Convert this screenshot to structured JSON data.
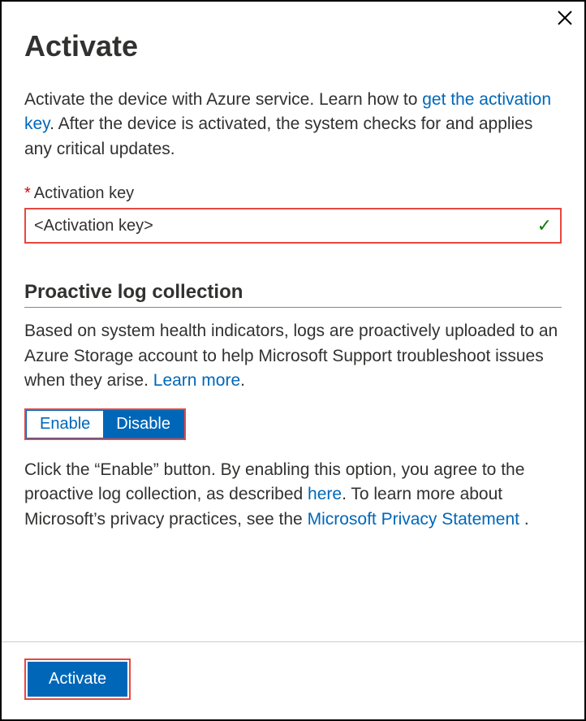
{
  "header": {
    "title": "Activate"
  },
  "intro": {
    "prefix": "Activate the device with Azure service. Learn how to ",
    "link": "get the activation key",
    "suffix": ". After the device is activated, the system checks for and applies any critical updates."
  },
  "activation": {
    "label": "Activation key",
    "value": "<Activation key>"
  },
  "proactive": {
    "heading": "Proactive log collection",
    "desc_prefix": "Based on system health indicators, logs are proactively uploaded to an Azure Storage account to help Microsoft Support troubleshoot issues when they arise. ",
    "desc_link": "Learn more",
    "desc_suffix": ".",
    "enable_label": "Enable",
    "disable_label": "Disable",
    "agree_part1": "Click the “Enable” button. By enabling this option, you agree to the proactive log collection, as described ",
    "agree_link1": "here",
    "agree_part2": ". To learn more about Microsoft’s privacy practices, see the ",
    "agree_link2": "Microsoft Privacy Statement",
    "agree_part3": " ."
  },
  "footer": {
    "activate_label": "Activate"
  }
}
